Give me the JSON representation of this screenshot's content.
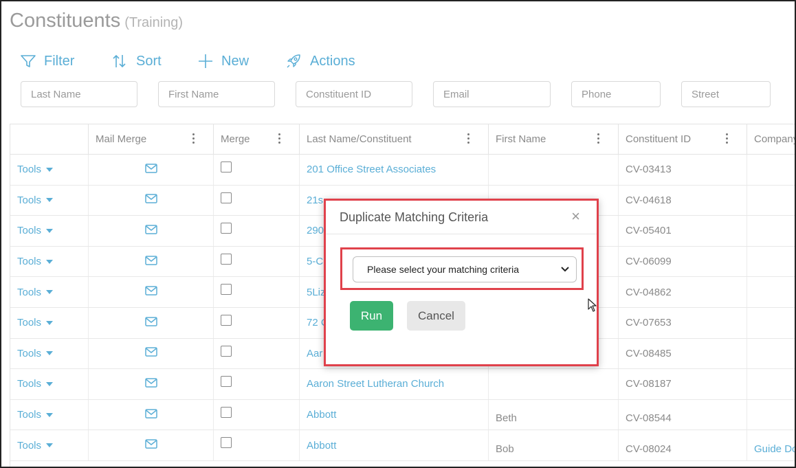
{
  "page": {
    "title": "Constituents",
    "subtitle": "(Training)"
  },
  "toolbar": {
    "filter": "Filter",
    "sort": "Sort",
    "new": "New",
    "actions": "Actions"
  },
  "filters": [
    "Last Name",
    "First Name",
    "Constituent ID",
    "Email",
    "Phone",
    "Street"
  ],
  "grid": {
    "headers": [
      "",
      "Mail Merge",
      "Merge",
      "Last Name/Constituent",
      "First Name",
      "Constituent ID",
      "Company"
    ],
    "tools_label": "Tools",
    "rows": [
      {
        "name": "201 Office Street Associates",
        "first": "",
        "id": "CV-03413",
        "company": ""
      },
      {
        "name": "21s",
        "first": "",
        "id": "CV-04618",
        "company": ""
      },
      {
        "name": "290",
        "first": "",
        "id": "CV-05401",
        "company": ""
      },
      {
        "name": "5-C",
        "first": "",
        "id": "CV-06099",
        "company": ""
      },
      {
        "name": "5Liz",
        "first": "",
        "id": "CV-04862",
        "company": ""
      },
      {
        "name": "72 C",
        "first": "",
        "id": "CV-07653",
        "company": ""
      },
      {
        "name": "Aar",
        "first": "",
        "id": "CV-08485",
        "company": ""
      },
      {
        "name": "Aaron Street Lutheran Church",
        "first": "",
        "id": "CV-08187",
        "company": ""
      },
      {
        "name": "Abbott",
        "first": "Beth",
        "id": "CV-08544",
        "company": ""
      },
      {
        "name": "Abbott",
        "first": "Bob",
        "id": "CV-08024",
        "company": "Guide Do"
      }
    ]
  },
  "modal": {
    "title": "Duplicate Matching Criteria",
    "close": "×",
    "select_value": "Please select your matching criteria",
    "run": "Run",
    "cancel": "Cancel"
  },
  "colors": {
    "accent": "#5aaed6",
    "run": "#3cb371",
    "highlight": "#e0414b"
  }
}
